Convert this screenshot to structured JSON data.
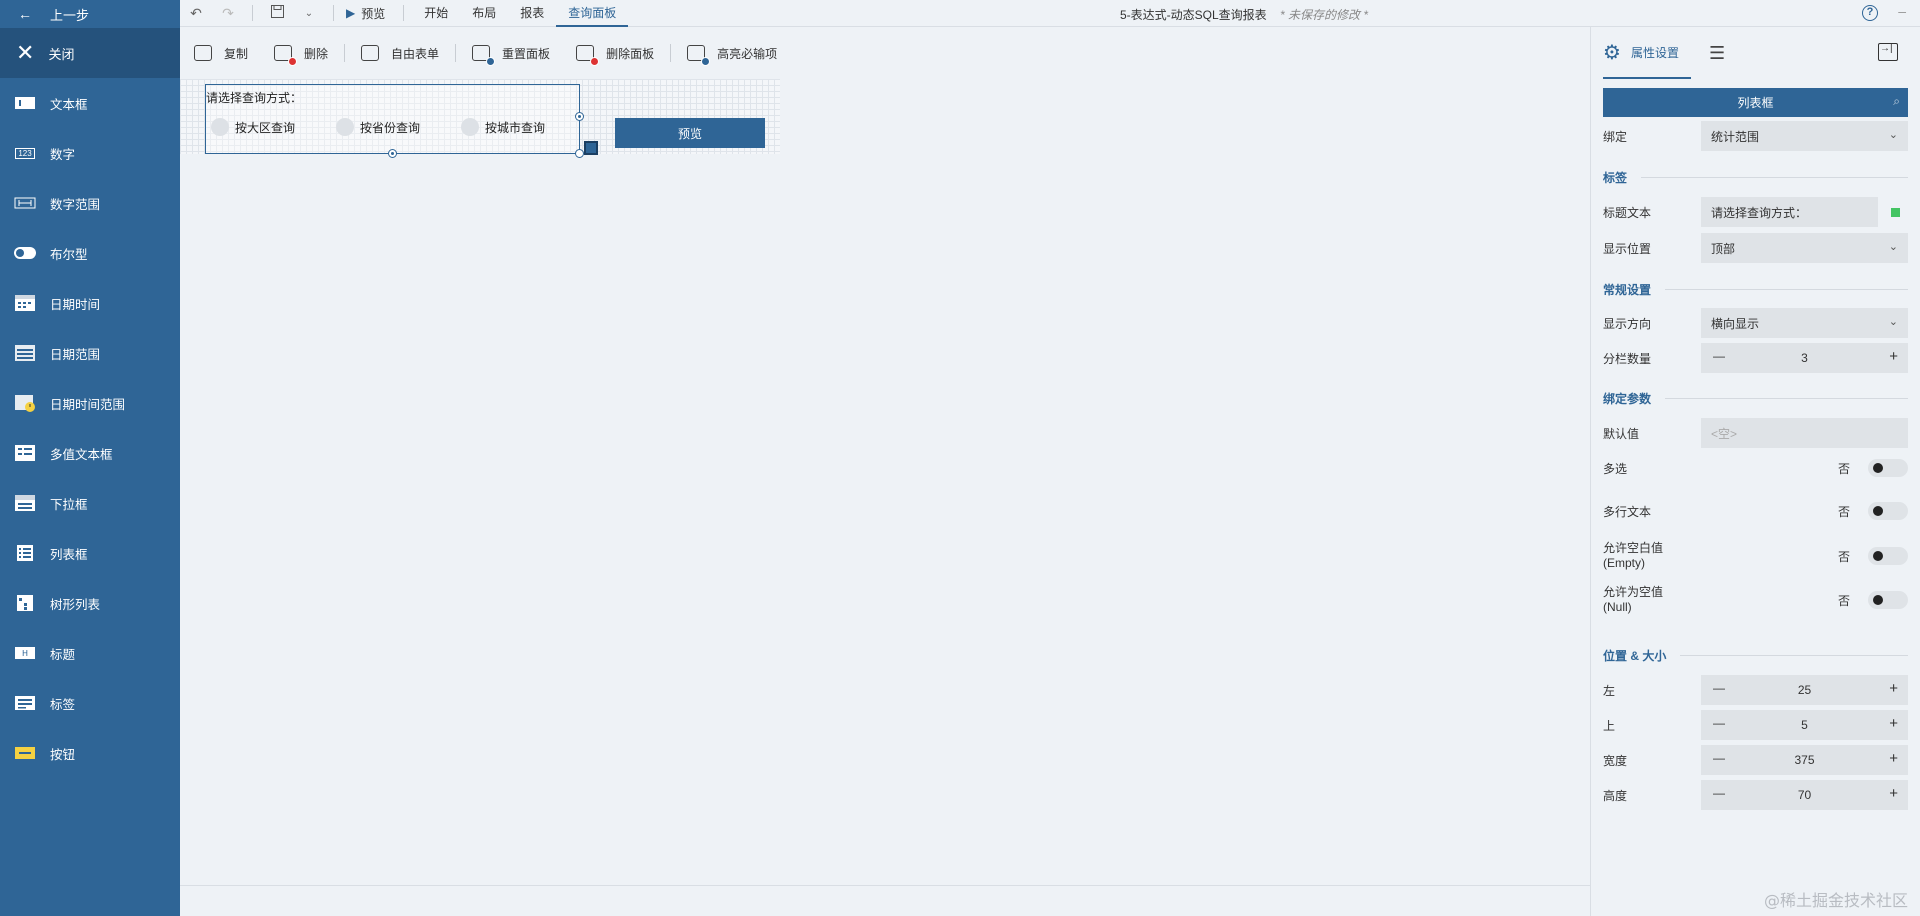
{
  "sidebar": {
    "back_label": "上一步",
    "close_label": "关闭",
    "items": [
      {
        "label": "文本框",
        "icon": "textbox-icon"
      },
      {
        "label": "数字",
        "icon": "number-icon"
      },
      {
        "label": "数字范围",
        "icon": "number-range-icon"
      },
      {
        "label": "布尔型",
        "icon": "boolean-toggle-icon"
      },
      {
        "label": "日期时间",
        "icon": "datetime-icon"
      },
      {
        "label": "日期范围",
        "icon": "date-range-icon"
      },
      {
        "label": "日期时间范围",
        "icon": "datetime-range-icon"
      },
      {
        "label": "多值文本框",
        "icon": "multi-value-textbox-icon"
      },
      {
        "label": "下拉框",
        "icon": "dropdown-icon"
      },
      {
        "label": "列表框",
        "icon": "listbox-icon"
      },
      {
        "label": "树形列表",
        "icon": "tree-list-icon"
      },
      {
        "label": "标题",
        "icon": "heading-icon"
      },
      {
        "label": "标签",
        "icon": "label-icon"
      },
      {
        "label": "按钮",
        "icon": "button-icon"
      }
    ],
    "number_icon_text": "123"
  },
  "topbar": {
    "preview_label": "预览",
    "tabs": [
      "开始",
      "布局",
      "报表",
      "查询面板"
    ],
    "active_tab": "查询面板",
    "doc_title": "5-表达式-动态SQL查询报表",
    "unsaved": "* 未保存的修改 *",
    "help": "?"
  },
  "toolbar": {
    "copy": "复制",
    "delete": "删除",
    "free_form": "自由表单",
    "reset_panel": "重置面板",
    "delete_panel": "删除面板",
    "highlight_required": "高亮必输项"
  },
  "canvas": {
    "listbox_label": "请选择查询方式：",
    "options": [
      "按大区查询",
      "按省份查询",
      "按城市查询"
    ],
    "preview_button": "预览"
  },
  "panel": {
    "tab_properties": "属性设置",
    "header": "列表框",
    "bind_label": "绑定",
    "bind_value": "统计范围",
    "sec_label": "标签",
    "title_text_label": "标题文本",
    "title_text_value": "请选择查询方式：",
    "position_label": "显示位置",
    "position_value": "顶部",
    "sec_general": "常规设置",
    "direction_label": "显示方向",
    "direction_value": "横向显示",
    "columns_label": "分栏数量",
    "columns_value": "3",
    "sec_bind_params": "绑定参数",
    "default_label": "默认值",
    "default_value": "<空>",
    "multi_select_label": "多选",
    "multi_select_value": "否",
    "multiline_label": "多行文本",
    "multiline_value": "否",
    "allow_empty_label": "允许空白值",
    "allow_empty_sub": "(Empty)",
    "allow_empty_value": "否",
    "allow_null_label": "允许为空值",
    "allow_null_sub": "(Null)",
    "allow_null_value": "否",
    "sec_position": "位置 & 大小",
    "left_label": "左",
    "left_value": "25",
    "top_label": "上",
    "top_value": "5",
    "width_label": "宽度",
    "width_value": "375",
    "height_label": "高度",
    "height_value": "70"
  },
  "watermark": "@稀土掘金技术社区",
  "colors": {
    "primary": "#2f6596",
    "sidebar_dark": "#25527c",
    "accent_green": "#43c463",
    "danger": "#dd3333"
  }
}
